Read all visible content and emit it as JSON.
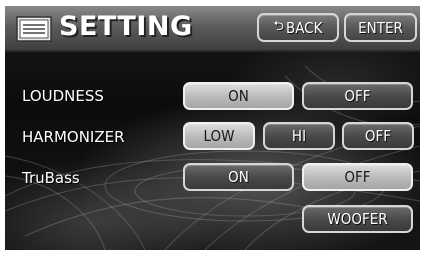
{
  "header": {
    "icon": "settings-list-icon",
    "title": "SETTING",
    "back_label": "BACK",
    "back_icon": "return-arrow-icon",
    "enter_label": "ENTER"
  },
  "settings": {
    "loudness": {
      "label": "LOUDNESS",
      "options": [
        "ON",
        "OFF"
      ],
      "selected": "ON"
    },
    "harmonizer": {
      "label": "HARMONIZER",
      "options": [
        "LOW",
        "HI",
        "OFF"
      ],
      "selected": "LOW"
    },
    "trubass": {
      "label": "TruBass",
      "options": [
        "ON",
        "OFF"
      ],
      "selected": "OFF"
    }
  },
  "woofer_label": "WOOFER",
  "colors": {
    "selected_button": "#b9b9b9",
    "unselected_button": "#4a4a4a",
    "button_border": "#d6d6d6",
    "background": "#111111"
  }
}
